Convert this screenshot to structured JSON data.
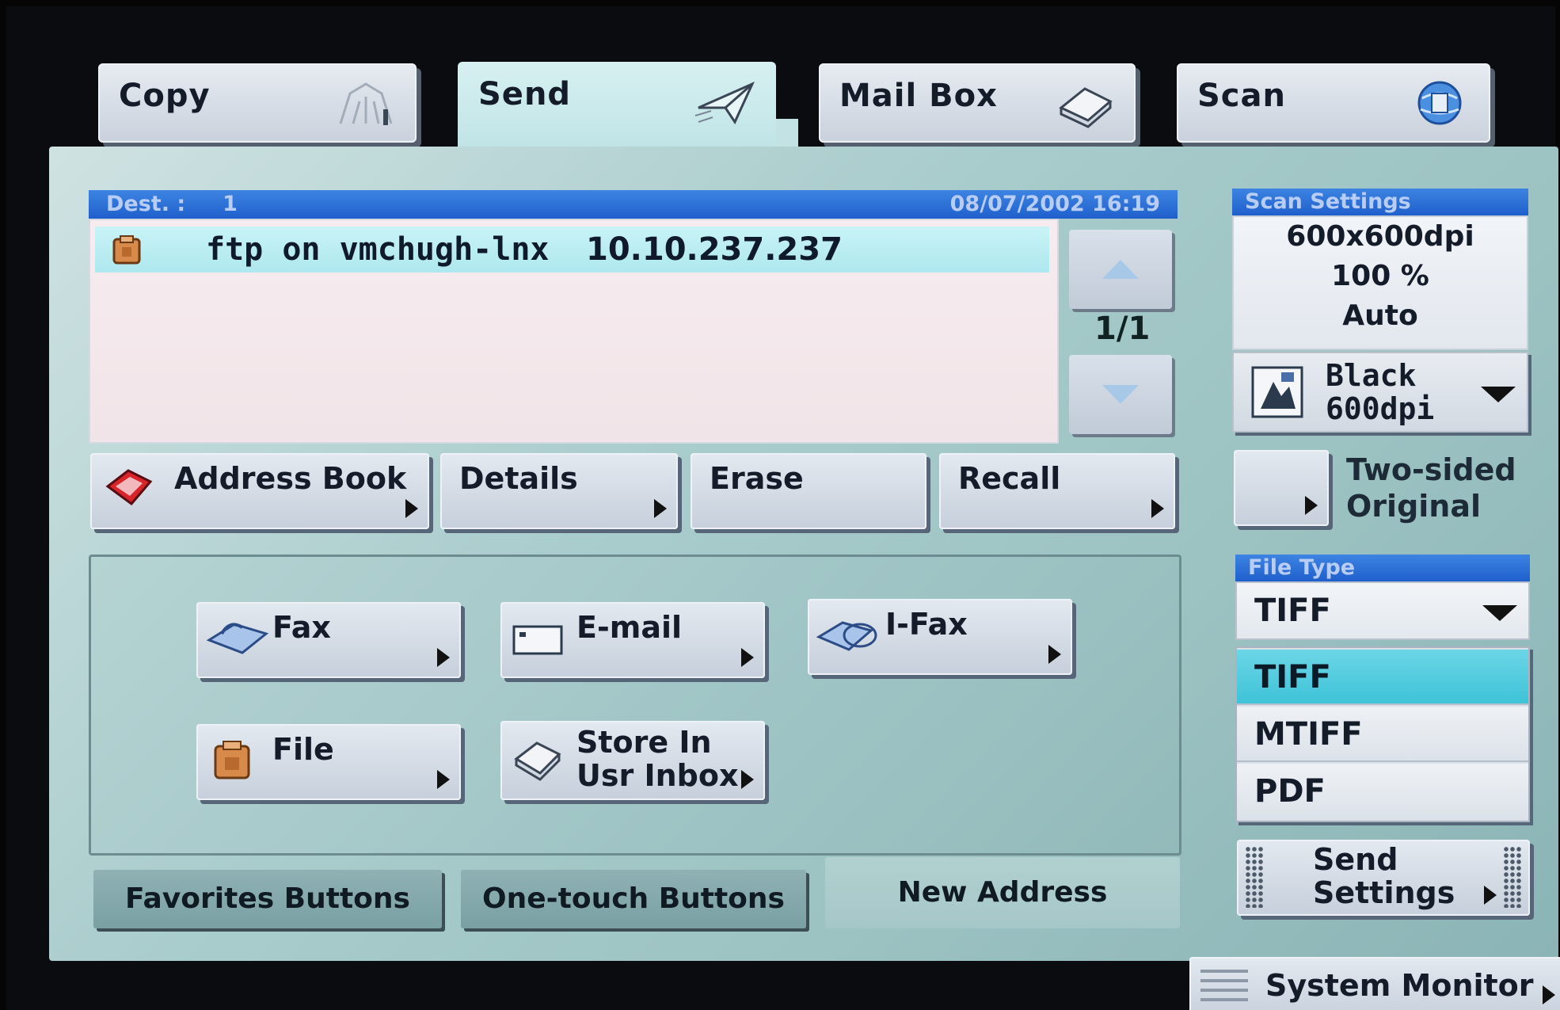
{
  "tabs": [
    {
      "label": "Copy",
      "icon": "copy-icon",
      "active": false
    },
    {
      "label": "Send",
      "icon": "paper-plane-icon",
      "active": true
    },
    {
      "label": "Mail Box",
      "icon": "mailbox-tray-icon",
      "active": false
    },
    {
      "label": "Scan",
      "icon": "globe-scan-icon",
      "active": false
    }
  ],
  "destination": {
    "header_label": "Dest. :",
    "count": "1",
    "datetime": "08/07/2002 16:19",
    "rows": [
      {
        "icon": "file-icon",
        "name": "ftp on vmchugh-lnx",
        "address": "10.10.237.237"
      }
    ],
    "page": "1/1"
  },
  "actions": {
    "address_book": "Address Book",
    "details": "Details",
    "erase": "Erase",
    "recall": "Recall"
  },
  "services": {
    "fax": "Fax",
    "email": "E-mail",
    "ifax": "I-Fax",
    "file": "File",
    "store_line1": "Store In",
    "store_line2": "Usr Inbox"
  },
  "bottom_tabs": {
    "favorites": "Favorites Buttons",
    "one_touch": "One-touch Buttons",
    "new_address": "New Address"
  },
  "scan_settings": {
    "header": "Scan Settings",
    "resolution": "600x600dpi",
    "zoom": "100 %",
    "density": "Auto",
    "color_line1": "Black",
    "color_line2": "600dpi"
  },
  "two_sided": {
    "line1": "Two-sided",
    "line2": "Original"
  },
  "file_type": {
    "header": "File Type",
    "selected": "TIFF",
    "options": [
      "TIFF",
      "MTIFF",
      "PDF"
    ]
  },
  "send_settings": {
    "line1": "Send",
    "line2": "Settings"
  },
  "system_monitor": "System Monitor",
  "colors": {
    "panel": "#a9cccc",
    "header_blue": "#2a6fd8",
    "highlight_cyan": "#3ec3d8"
  }
}
